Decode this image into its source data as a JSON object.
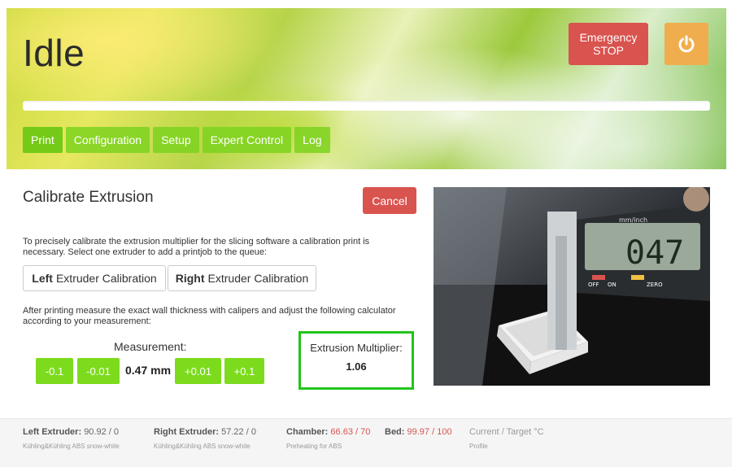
{
  "header": {
    "status_title": "Idle",
    "emergency_label_1": "Emergency",
    "emergency_label_2": "STOP",
    "power_icon": "power-icon",
    "progress_percent": 0
  },
  "tabs": [
    {
      "label": "Print"
    },
    {
      "label": "Configuration"
    },
    {
      "label": "Setup"
    },
    {
      "label": "Expert Control"
    },
    {
      "label": "Log"
    }
  ],
  "calibration": {
    "title": "Calibrate Extrusion",
    "cancel_label": "Cancel",
    "intro_text": "To precisely calibrate the extrusion multiplier for the slicing software a calibration print is necessary. Select one extruder to add a printjob to the queue:",
    "left_btn_bold": "Left",
    "left_btn_rest": "Extruder Calibration",
    "right_btn_bold": "Right",
    "right_btn_rest": "Extruder Calibration",
    "after_text": "After printing measure the exact wall thickness with calipers and adjust the following calculator according to your measurement:",
    "measurement_label": "Measurement:",
    "step_minus_big": "-0.1",
    "step_minus_small": "-0.01",
    "measurement_value": "0.47 mm",
    "step_plus_small": "+0.01",
    "step_plus_big": "+0.1",
    "multiplier_label": "Extrusion Multiplier:",
    "multiplier_value": "1.06"
  },
  "photo": {
    "caliper_unit_label": "mm/inch",
    "caliper_reading": "047",
    "caliper_off": "OFF",
    "caliper_on": "ON",
    "caliper_zero": "ZERO"
  },
  "footer": {
    "left_label": "Left Extruder:",
    "left_value": "90.92 / 0",
    "left_material": "Kühling&Kühling ABS snow-white",
    "right_label": "Right Extruder:",
    "right_value": "57.22 / 0",
    "right_material": "Kühling&Kühling ABS snow-white",
    "chamber_label": "Chamber:",
    "chamber_value": "66.63 / 70",
    "chamber_note": "Preheating for ABS",
    "bed_label": "Bed:",
    "bed_value": "99.97 / 100",
    "legend_label": "Current / Target °C",
    "legend_note": "Profile"
  },
  "colors": {
    "danger": "#d9534f",
    "warning": "#f0ad4e",
    "accent_green": "#7ddb1e"
  }
}
